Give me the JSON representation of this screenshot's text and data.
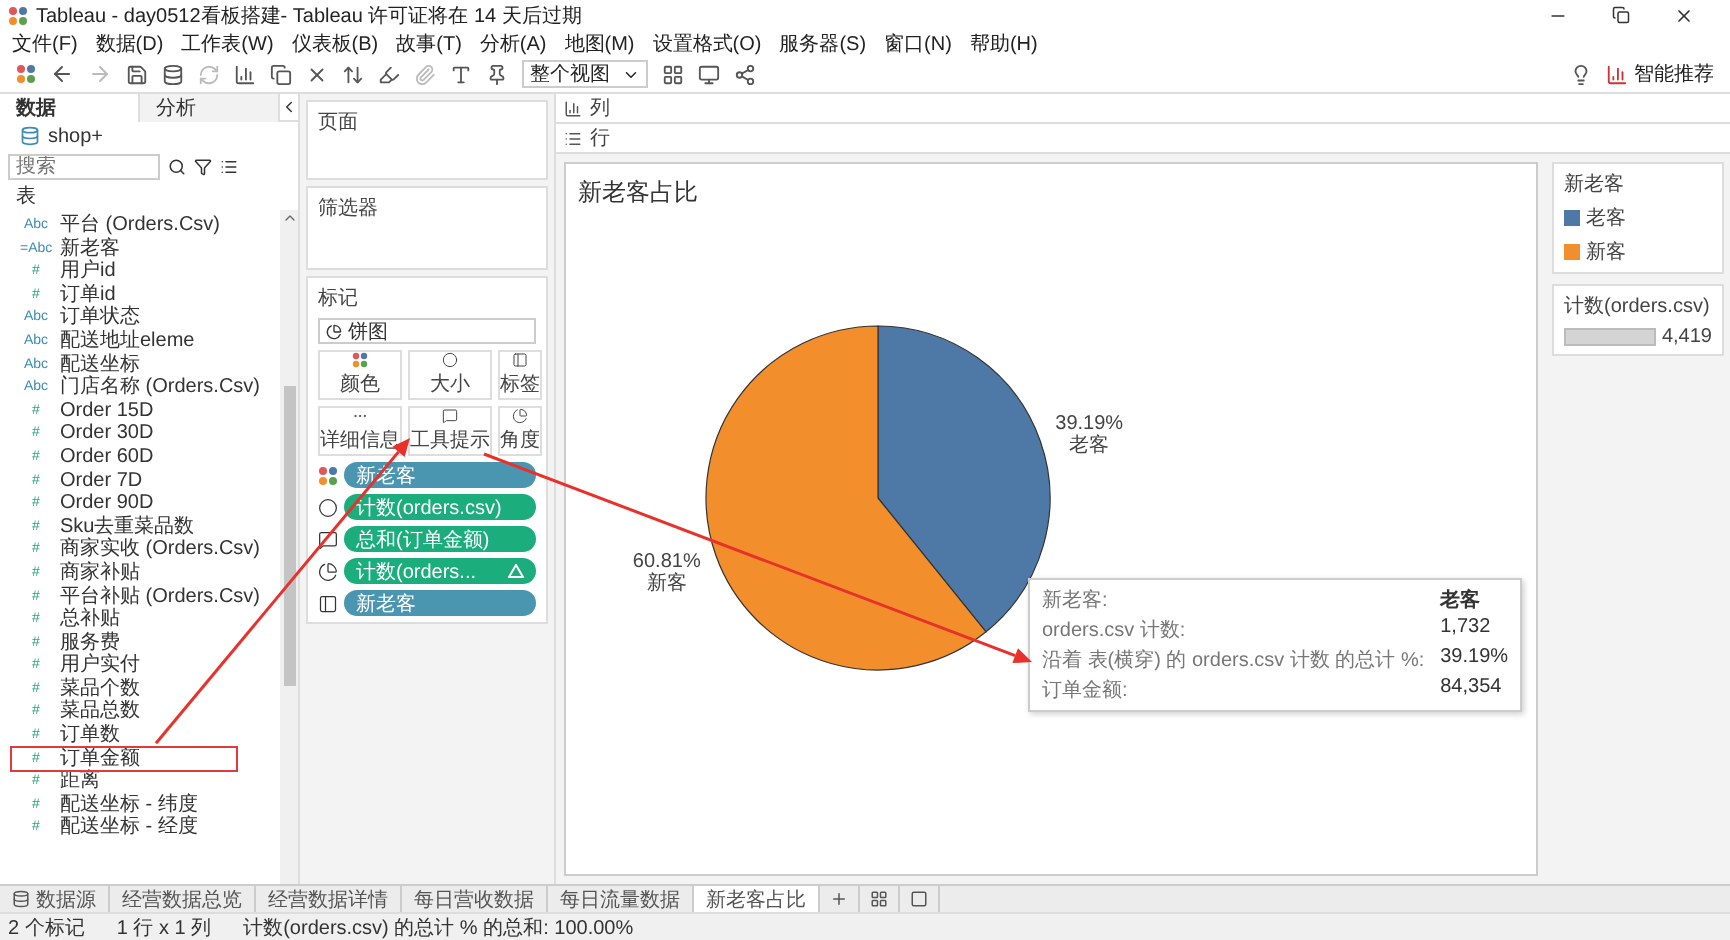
{
  "window": {
    "title": "Tableau - day0512看板搭建- Tableau 许可证将在 14 天后过期"
  },
  "menu": [
    "文件(F)",
    "数据(D)",
    "工作表(W)",
    "仪表板(B)",
    "故事(T)",
    "分析(A)",
    "地图(M)",
    "设置格式(O)",
    "服务器(S)",
    "窗口(N)",
    "帮助(H)"
  ],
  "toolbar": {
    "view_mode": "整个视图",
    "recommend_button": "智能推荐"
  },
  "data_pane": {
    "tabs": [
      {
        "label": "数据",
        "selected": true
      },
      {
        "label": "分析",
        "selected": false
      }
    ],
    "source": "shop+",
    "search": {
      "placeholder": "搜索"
    },
    "section": "表",
    "fields": [
      {
        "type_icon": "Abc",
        "kind": "dimension",
        "name": "平台 (Orders.Csv)",
        "boxed": false
      },
      {
        "type_icon": "=Abc",
        "kind": "dimension",
        "name": "新老客",
        "boxed": false
      },
      {
        "type_icon": "#",
        "kind": "measure",
        "name": "用户id",
        "boxed": false
      },
      {
        "type_icon": "#",
        "kind": "measure",
        "name": "订单id",
        "boxed": false
      },
      {
        "type_icon": "Abc",
        "kind": "dimension",
        "name": "订单状态",
        "boxed": false
      },
      {
        "type_icon": "Abc",
        "kind": "dimension",
        "name": "配送地址eleme",
        "boxed": false
      },
      {
        "type_icon": "Abc",
        "kind": "dimension",
        "name": "配送坐标",
        "boxed": false
      },
      {
        "type_icon": "Abc",
        "kind": "dimension",
        "name": "门店名称 (Orders.Csv)",
        "boxed": false
      },
      {
        "type_icon": "#",
        "kind": "measure",
        "name": "Order 15D",
        "boxed": false
      },
      {
        "type_icon": "#",
        "kind": "measure",
        "name": "Order 30D",
        "boxed": false
      },
      {
        "type_icon": "#",
        "kind": "measure",
        "name": "Order 60D",
        "boxed": false
      },
      {
        "type_icon": "#",
        "kind": "measure",
        "name": "Order 7D",
        "boxed": false
      },
      {
        "type_icon": "#",
        "kind": "measure",
        "name": "Order 90D",
        "boxed": false
      },
      {
        "type_icon": "#",
        "kind": "measure",
        "name": "Sku去重菜品数",
        "boxed": false
      },
      {
        "type_icon": "#",
        "kind": "measure",
        "name": "商家实收 (Orders.Csv)",
        "boxed": false
      },
      {
        "type_icon": "#",
        "kind": "measure",
        "name": "商家补贴",
        "boxed": false
      },
      {
        "type_icon": "#",
        "kind": "measure",
        "name": "平台补贴 (Orders.Csv)",
        "boxed": false
      },
      {
        "type_icon": "#",
        "kind": "measure",
        "name": "总补贴",
        "boxed": false
      },
      {
        "type_icon": "#",
        "kind": "measure",
        "name": "服务费",
        "boxed": false
      },
      {
        "type_icon": "#",
        "kind": "measure",
        "name": "用户实付",
        "boxed": false
      },
      {
        "type_icon": "#",
        "kind": "measure",
        "name": "菜品个数",
        "boxed": false
      },
      {
        "type_icon": "#",
        "kind": "measure",
        "name": "菜品总数",
        "boxed": false
      },
      {
        "type_icon": "#",
        "kind": "measure",
        "name": "订单数",
        "boxed": false
      },
      {
        "type_icon": "#",
        "kind": "measure",
        "name": "订单金额",
        "boxed": true
      },
      {
        "type_icon": "#",
        "kind": "measure",
        "name": "距离",
        "boxed": false
      },
      {
        "type_icon": "#",
        "kind": "measure",
        "name": "配送坐标 - 纬度",
        "boxed": false
      },
      {
        "type_icon": "#",
        "kind": "measure",
        "name": "配送坐标 - 经度",
        "boxed": false
      }
    ]
  },
  "shelves": {
    "pages": "页面",
    "filters": "筛选器",
    "columns": "列",
    "rows": "行"
  },
  "marks": {
    "title": "标记",
    "mark_type": "饼图",
    "buttons": [
      {
        "kind": "color",
        "label": "颜色"
      },
      {
        "kind": "size",
        "label": "大小"
      },
      {
        "kind": "label",
        "label": "标签"
      },
      {
        "kind": "detail",
        "label": "详细信息"
      },
      {
        "kind": "tooltip",
        "label": "工具提示"
      },
      {
        "kind": "angle",
        "label": "角度"
      }
    ],
    "pills": [
      {
        "kind": "color",
        "measure": false,
        "label": "新老客",
        "table_calc": false
      },
      {
        "kind": "size",
        "measure": true,
        "label": "计数(orders.csv)",
        "table_calc": false
      },
      {
        "kind": "tooltip",
        "measure": true,
        "label": "总和(订单金额)",
        "table_calc": false
      },
      {
        "kind": "angle",
        "measure": true,
        "label": "计数(orders...",
        "table_calc": true
      },
      {
        "kind": "label",
        "measure": false,
        "label": "新老客",
        "table_calc": false
      }
    ]
  },
  "view": {
    "title": "新老客占比",
    "chart_data": {
      "type": "pie",
      "categories": [
        "老客",
        "新客"
      ],
      "values": [
        39.19,
        60.81
      ],
      "data_labels": true,
      "value_labels": [
        "39.19%",
        "60.81%"
      ]
    },
    "tooltip": {
      "rows": [
        {
          "label": "新老客:",
          "value": "老客",
          "emphasis": true
        },
        {
          "label": "orders.csv 计数:",
          "value": "1,732",
          "emphasis": false
        },
        {
          "label": "沿着 表(横穿) 的 orders.csv 计数 的总计 %:",
          "value": "39.19%",
          "emphasis": false
        },
        {
          "label": "订单金额:",
          "value": "84,354",
          "emphasis": false
        }
      ]
    }
  },
  "legends": {
    "color": {
      "title": "新老客",
      "items": [
        {
          "label": "老客",
          "color": "#4e79a7"
        },
        {
          "label": "新客",
          "color": "#f28e2b"
        }
      ]
    },
    "size": {
      "title": "计数(orders.csv)",
      "value": "4,419"
    }
  },
  "sheet_tabs": {
    "data_source": "数据源",
    "tabs": [
      {
        "label": "经营数据总览",
        "selected": false
      },
      {
        "label": "经营数据详情",
        "selected": false
      },
      {
        "label": "每日营收数据",
        "selected": false
      },
      {
        "label": "每日流量数据",
        "selected": false
      },
      {
        "label": "新老客占比",
        "selected": true
      }
    ]
  },
  "status_bar": [
    "2 个标记",
    "1 行 x 1 列",
    "计数(orders.csv) 的总计 % 的总和: 100.00%"
  ]
}
